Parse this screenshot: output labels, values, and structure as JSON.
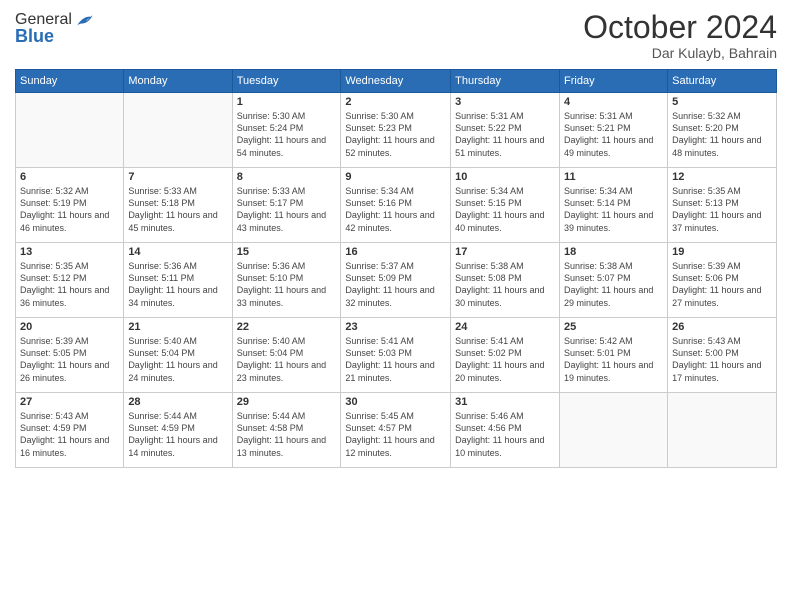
{
  "logo": {
    "general": "General",
    "blue": "Blue"
  },
  "title": "October 2024",
  "location": "Dar Kulayb, Bahrain",
  "days_header": [
    "Sunday",
    "Monday",
    "Tuesday",
    "Wednesday",
    "Thursday",
    "Friday",
    "Saturday"
  ],
  "weeks": [
    [
      {
        "num": "",
        "info": ""
      },
      {
        "num": "",
        "info": ""
      },
      {
        "num": "1",
        "info": "Sunrise: 5:30 AM\nSunset: 5:24 PM\nDaylight: 11 hours and 54 minutes."
      },
      {
        "num": "2",
        "info": "Sunrise: 5:30 AM\nSunset: 5:23 PM\nDaylight: 11 hours and 52 minutes."
      },
      {
        "num": "3",
        "info": "Sunrise: 5:31 AM\nSunset: 5:22 PM\nDaylight: 11 hours and 51 minutes."
      },
      {
        "num": "4",
        "info": "Sunrise: 5:31 AM\nSunset: 5:21 PM\nDaylight: 11 hours and 49 minutes."
      },
      {
        "num": "5",
        "info": "Sunrise: 5:32 AM\nSunset: 5:20 PM\nDaylight: 11 hours and 48 minutes."
      }
    ],
    [
      {
        "num": "6",
        "info": "Sunrise: 5:32 AM\nSunset: 5:19 PM\nDaylight: 11 hours and 46 minutes."
      },
      {
        "num": "7",
        "info": "Sunrise: 5:33 AM\nSunset: 5:18 PM\nDaylight: 11 hours and 45 minutes."
      },
      {
        "num": "8",
        "info": "Sunrise: 5:33 AM\nSunset: 5:17 PM\nDaylight: 11 hours and 43 minutes."
      },
      {
        "num": "9",
        "info": "Sunrise: 5:34 AM\nSunset: 5:16 PM\nDaylight: 11 hours and 42 minutes."
      },
      {
        "num": "10",
        "info": "Sunrise: 5:34 AM\nSunset: 5:15 PM\nDaylight: 11 hours and 40 minutes."
      },
      {
        "num": "11",
        "info": "Sunrise: 5:34 AM\nSunset: 5:14 PM\nDaylight: 11 hours and 39 minutes."
      },
      {
        "num": "12",
        "info": "Sunrise: 5:35 AM\nSunset: 5:13 PM\nDaylight: 11 hours and 37 minutes."
      }
    ],
    [
      {
        "num": "13",
        "info": "Sunrise: 5:35 AM\nSunset: 5:12 PM\nDaylight: 11 hours and 36 minutes."
      },
      {
        "num": "14",
        "info": "Sunrise: 5:36 AM\nSunset: 5:11 PM\nDaylight: 11 hours and 34 minutes."
      },
      {
        "num": "15",
        "info": "Sunrise: 5:36 AM\nSunset: 5:10 PM\nDaylight: 11 hours and 33 minutes."
      },
      {
        "num": "16",
        "info": "Sunrise: 5:37 AM\nSunset: 5:09 PM\nDaylight: 11 hours and 32 minutes."
      },
      {
        "num": "17",
        "info": "Sunrise: 5:38 AM\nSunset: 5:08 PM\nDaylight: 11 hours and 30 minutes."
      },
      {
        "num": "18",
        "info": "Sunrise: 5:38 AM\nSunset: 5:07 PM\nDaylight: 11 hours and 29 minutes."
      },
      {
        "num": "19",
        "info": "Sunrise: 5:39 AM\nSunset: 5:06 PM\nDaylight: 11 hours and 27 minutes."
      }
    ],
    [
      {
        "num": "20",
        "info": "Sunrise: 5:39 AM\nSunset: 5:05 PM\nDaylight: 11 hours and 26 minutes."
      },
      {
        "num": "21",
        "info": "Sunrise: 5:40 AM\nSunset: 5:04 PM\nDaylight: 11 hours and 24 minutes."
      },
      {
        "num": "22",
        "info": "Sunrise: 5:40 AM\nSunset: 5:04 PM\nDaylight: 11 hours and 23 minutes."
      },
      {
        "num": "23",
        "info": "Sunrise: 5:41 AM\nSunset: 5:03 PM\nDaylight: 11 hours and 21 minutes."
      },
      {
        "num": "24",
        "info": "Sunrise: 5:41 AM\nSunset: 5:02 PM\nDaylight: 11 hours and 20 minutes."
      },
      {
        "num": "25",
        "info": "Sunrise: 5:42 AM\nSunset: 5:01 PM\nDaylight: 11 hours and 19 minutes."
      },
      {
        "num": "26",
        "info": "Sunrise: 5:43 AM\nSunset: 5:00 PM\nDaylight: 11 hours and 17 minutes."
      }
    ],
    [
      {
        "num": "27",
        "info": "Sunrise: 5:43 AM\nSunset: 4:59 PM\nDaylight: 11 hours and 16 minutes."
      },
      {
        "num": "28",
        "info": "Sunrise: 5:44 AM\nSunset: 4:59 PM\nDaylight: 11 hours and 14 minutes."
      },
      {
        "num": "29",
        "info": "Sunrise: 5:44 AM\nSunset: 4:58 PM\nDaylight: 11 hours and 13 minutes."
      },
      {
        "num": "30",
        "info": "Sunrise: 5:45 AM\nSunset: 4:57 PM\nDaylight: 11 hours and 12 minutes."
      },
      {
        "num": "31",
        "info": "Sunrise: 5:46 AM\nSunset: 4:56 PM\nDaylight: 11 hours and 10 minutes."
      },
      {
        "num": "",
        "info": ""
      },
      {
        "num": "",
        "info": ""
      }
    ]
  ]
}
